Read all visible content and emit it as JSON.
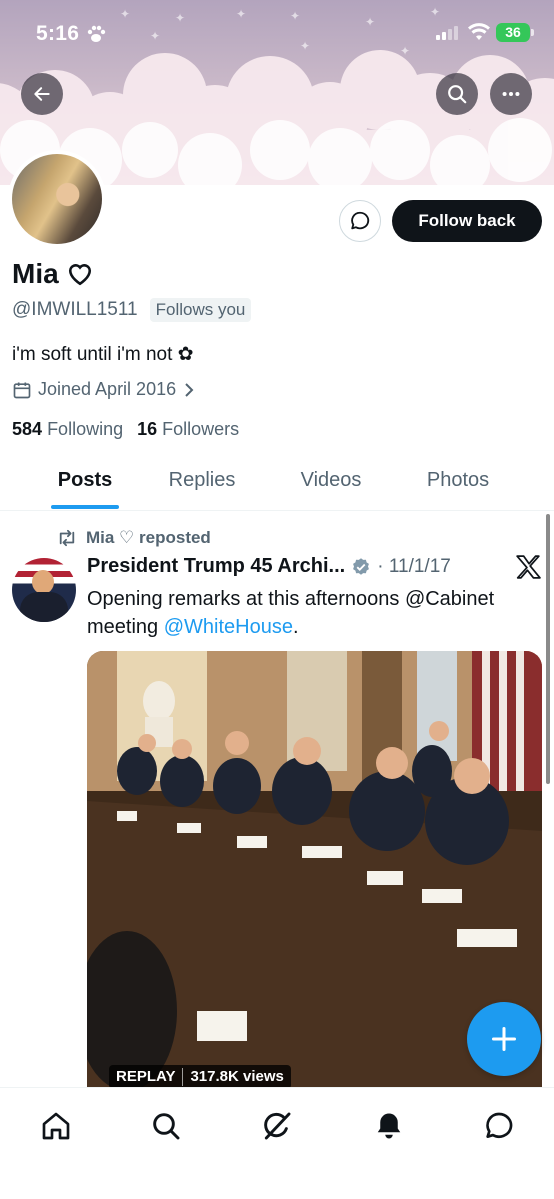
{
  "status_bar": {
    "time": "5:16",
    "battery": "36"
  },
  "profile": {
    "name": "Mia",
    "handle": "@IMWILL1511",
    "follows_you": "Follows you",
    "bio": "i'm soft until i'm not ✿",
    "joined": "Joined April 2016",
    "following_count": "584",
    "following_label": "Following",
    "followers_count": "16",
    "followers_label": "Followers",
    "follow_button": "Follow back"
  },
  "tabs": [
    {
      "label": "Posts",
      "active": true
    },
    {
      "label": "Replies",
      "active": false
    },
    {
      "label": "Videos",
      "active": false
    },
    {
      "label": "Photos",
      "active": false
    }
  ],
  "post": {
    "repost_label": "Mia ♡ reposted",
    "author": "President Trump 45 Archi...",
    "date": "· 11/1/17",
    "text": "Opening remarks at this afternoons @Cabinet meeting ",
    "mention": "@WhiteHouse",
    "text_end": ".",
    "media_replay": "REPLAY",
    "media_views": "317.8K views"
  },
  "icons": {
    "back": "arrow-left-icon",
    "search": "search-icon",
    "more": "more-horizontal-icon",
    "message": "message-icon",
    "calendar": "calendar-icon",
    "repost": "repost-icon",
    "verified": "verified-badge-icon",
    "x": "x-logo-icon",
    "compose": "plus-icon",
    "nav": [
      "home-icon",
      "search-icon",
      "grok-icon",
      "notifications-icon",
      "messages-icon"
    ]
  },
  "colors": {
    "accent": "#1d9bf0",
    "text": "#0f1419",
    "muted": "#536471",
    "battery": "#34c759"
  }
}
